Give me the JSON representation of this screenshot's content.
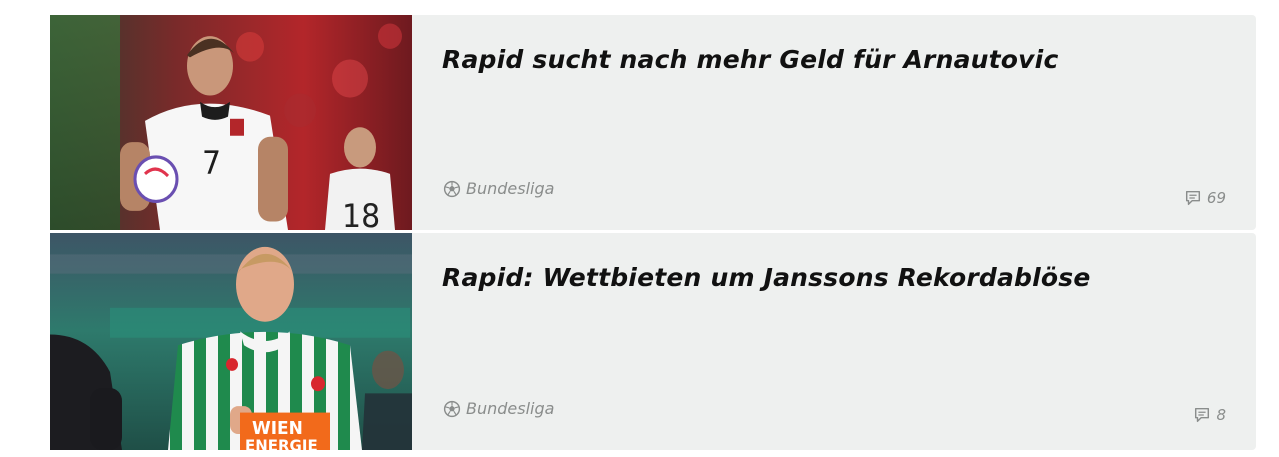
{
  "articles": [
    {
      "title": "Rapid sucht nach mehr Geld für Arnautovic",
      "category": "Bundesliga",
      "category_icon": "soccer-ball-icon",
      "comment_icon": "comment-icon",
      "comments": "69",
      "image": {
        "subject": "player-white-jersey",
        "jersey_number": "7",
        "background_player_number": "18"
      }
    },
    {
      "title": "Rapid: Wettbieten um Janssons Rekordablöse",
      "category": "Bundesliga",
      "category_icon": "soccer-ball-icon",
      "comment_icon": "comment-icon",
      "comments": "8",
      "image": {
        "subject": "player-green-white-striped-jersey",
        "sponsor_line1": "WIEN",
        "sponsor_line2": "ENERGIE"
      }
    }
  ],
  "colors": {
    "card_background": "#eef0ef",
    "headline": "#111111",
    "meta_text": "#8a8d8c"
  }
}
